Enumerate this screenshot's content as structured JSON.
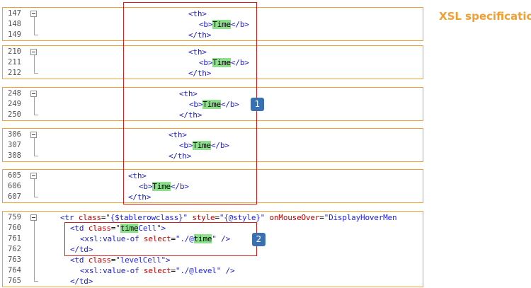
{
  "title": "XSL specification",
  "badges": [
    "1",
    "2"
  ],
  "blocks": [
    {
      "lines": [
        {
          "n": "147",
          "indent": 265,
          "parts": [
            {
              "c": "t",
              "s": "<th>"
            }
          ]
        },
        {
          "n": "148",
          "indent": 280,
          "parts": [
            {
              "c": "t",
              "s": "<b>"
            },
            {
              "c": "hl",
              "s": "Time"
            },
            {
              "c": "t",
              "s": "</b>"
            }
          ]
        },
        {
          "n": "149",
          "indent": 265,
          "parts": [
            {
              "c": "t",
              "s": "</th>"
            }
          ]
        }
      ]
    },
    {
      "lines": [
        {
          "n": "210",
          "indent": 265,
          "parts": [
            {
              "c": "t",
              "s": "<th>"
            }
          ]
        },
        {
          "n": "211",
          "indent": 280,
          "parts": [
            {
              "c": "t",
              "s": "<b>"
            },
            {
              "c": "hl",
              "s": "Time"
            },
            {
              "c": "t",
              "s": "</b>"
            }
          ]
        },
        {
          "n": "212",
          "indent": 265,
          "parts": [
            {
              "c": "t",
              "s": "</th>"
            }
          ]
        }
      ]
    },
    {
      "lines": [
        {
          "n": "248",
          "indent": 252,
          "parts": [
            {
              "c": "t",
              "s": "<th>"
            }
          ]
        },
        {
          "n": "249",
          "indent": 266,
          "parts": [
            {
              "c": "t",
              "s": "<b>"
            },
            {
              "c": "hl",
              "s": "Time"
            },
            {
              "c": "t",
              "s": "</b>"
            }
          ]
        },
        {
          "n": "250",
          "indent": 252,
          "parts": [
            {
              "c": "t",
              "s": "</th>"
            }
          ]
        }
      ]
    },
    {
      "lines": [
        {
          "n": "306",
          "indent": 237,
          "parts": [
            {
              "c": "t",
              "s": "<th>"
            }
          ]
        },
        {
          "n": "307",
          "indent": 252,
          "parts": [
            {
              "c": "t",
              "s": "<b>"
            },
            {
              "c": "hl",
              "s": "Time"
            },
            {
              "c": "t",
              "s": "</b>"
            }
          ]
        },
        {
          "n": "308",
          "indent": 237,
          "parts": [
            {
              "c": "t",
              "s": "</th>"
            }
          ]
        }
      ]
    },
    {
      "lines": [
        {
          "n": "605",
          "indent": 180,
          "parts": [
            {
              "c": "t",
              "s": "<th>"
            }
          ]
        },
        {
          "n": "606",
          "indent": 195,
          "parts": [
            {
              "c": "t",
              "s": "<b>"
            },
            {
              "c": "hl",
              "s": "Time"
            },
            {
              "c": "t",
              "s": "</b>"
            }
          ]
        },
        {
          "n": "607",
          "indent": 180,
          "parts": [
            {
              "c": "t",
              "s": "</th>"
            }
          ]
        }
      ]
    },
    {
      "lines": [
        {
          "n": "759",
          "indent": 84,
          "parts": [
            {
              "c": "t",
              "s": "<tr "
            },
            {
              "c": "a",
              "s": "class"
            },
            {
              "c": "x",
              "s": "="
            },
            {
              "c": "v",
              "s": "\"{$tablerowclass}\""
            },
            {
              "c": "x",
              "s": " "
            },
            {
              "c": "a",
              "s": "style"
            },
            {
              "c": "x",
              "s": "="
            },
            {
              "c": "v",
              "s": "\"{@style}\""
            },
            {
              "c": "x",
              "s": " "
            },
            {
              "c": "a",
              "s": "onMouseOver"
            },
            {
              "c": "x",
              "s": "="
            },
            {
              "c": "v",
              "s": "\"DisplayHoverMen"
            }
          ]
        },
        {
          "n": "760",
          "indent": 98,
          "parts": [
            {
              "c": "t",
              "s": "<td "
            },
            {
              "c": "a",
              "s": "class"
            },
            {
              "c": "x",
              "s": "="
            },
            {
              "c": "v",
              "s": "\""
            },
            {
              "c": "hl",
              "s": "time"
            },
            {
              "c": "v",
              "s": "Cell\""
            },
            {
              "c": "t",
              "s": ">"
            }
          ]
        },
        {
          "n": "761",
          "indent": 112,
          "parts": [
            {
              "c": "t",
              "s": "<xsl:value-of "
            },
            {
              "c": "a",
              "s": "select"
            },
            {
              "c": "x",
              "s": "="
            },
            {
              "c": "v",
              "s": "\"./@"
            },
            {
              "c": "hl",
              "s": "time"
            },
            {
              "c": "v",
              "s": "\""
            },
            {
              "c": "t",
              "s": " />"
            }
          ]
        },
        {
          "n": "762",
          "indent": 98,
          "parts": [
            {
              "c": "t",
              "s": "</td>"
            }
          ]
        },
        {
          "n": "763",
          "indent": 98,
          "parts": [
            {
              "c": "t",
              "s": "<td "
            },
            {
              "c": "a",
              "s": "class"
            },
            {
              "c": "x",
              "s": "="
            },
            {
              "c": "v",
              "s": "\"levelCell\""
            },
            {
              "c": "t",
              "s": ">"
            }
          ]
        },
        {
          "n": "764",
          "indent": 112,
          "parts": [
            {
              "c": "t",
              "s": "<xsl:value-of "
            },
            {
              "c": "a",
              "s": "select"
            },
            {
              "c": "x",
              "s": "="
            },
            {
              "c": "v",
              "s": "\"./@level\""
            },
            {
              "c": "t",
              "s": " />"
            }
          ]
        },
        {
          "n": "765",
          "indent": 98,
          "parts": [
            {
              "c": "t",
              "s": "</td>"
            }
          ]
        }
      ]
    }
  ]
}
